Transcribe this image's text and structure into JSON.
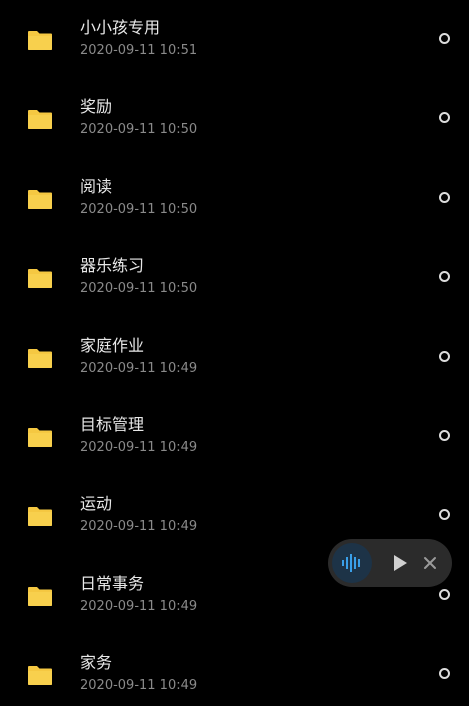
{
  "files": [
    {
      "name": "小小孩专用",
      "time": "2020-09-11 10:51"
    },
    {
      "name": "奖励",
      "time": "2020-09-11 10:50"
    },
    {
      "name": "阅读",
      "time": "2020-09-11 10:50"
    },
    {
      "name": "器乐练习",
      "time": "2020-09-11 10:50"
    },
    {
      "name": "家庭作业",
      "time": "2020-09-11 10:49"
    },
    {
      "name": "目标管理",
      "time": "2020-09-11 10:49"
    },
    {
      "name": "运动",
      "time": "2020-09-11 10:49"
    },
    {
      "name": "日常事务",
      "time": "2020-09-11 10:49"
    },
    {
      "name": "家务",
      "time": "2020-09-11 10:49"
    }
  ],
  "colors": {
    "background": "#000000",
    "folder": "#f5c842",
    "accent_wave": "#3a9fe8"
  },
  "icons": {
    "folder": "folder-icon",
    "select": "radio-circle-icon",
    "player_wave": "audio-wave-icon",
    "player_play": "play-icon",
    "player_close": "close-icon"
  }
}
